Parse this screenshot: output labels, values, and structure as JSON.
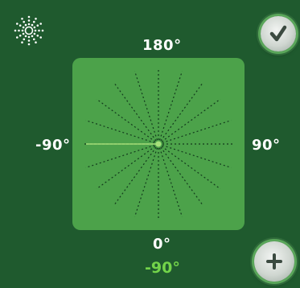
{
  "labels": {
    "top": "180°",
    "left": "-90°",
    "right": "90°",
    "bottom": "0°"
  },
  "current_angle": "-90°",
  "buttons": {
    "confirm_icon": "checkmark-icon",
    "add_icon": "plus-icon"
  },
  "logo_icon": "starburst-icon",
  "dial": {
    "ray_count": 20,
    "selected_angle_deg": -90
  },
  "colors": {
    "background": "#1f5a2e",
    "panel": "#4ca24a",
    "selected_line": "#a6e07a",
    "accent_text": "#73d44a"
  }
}
